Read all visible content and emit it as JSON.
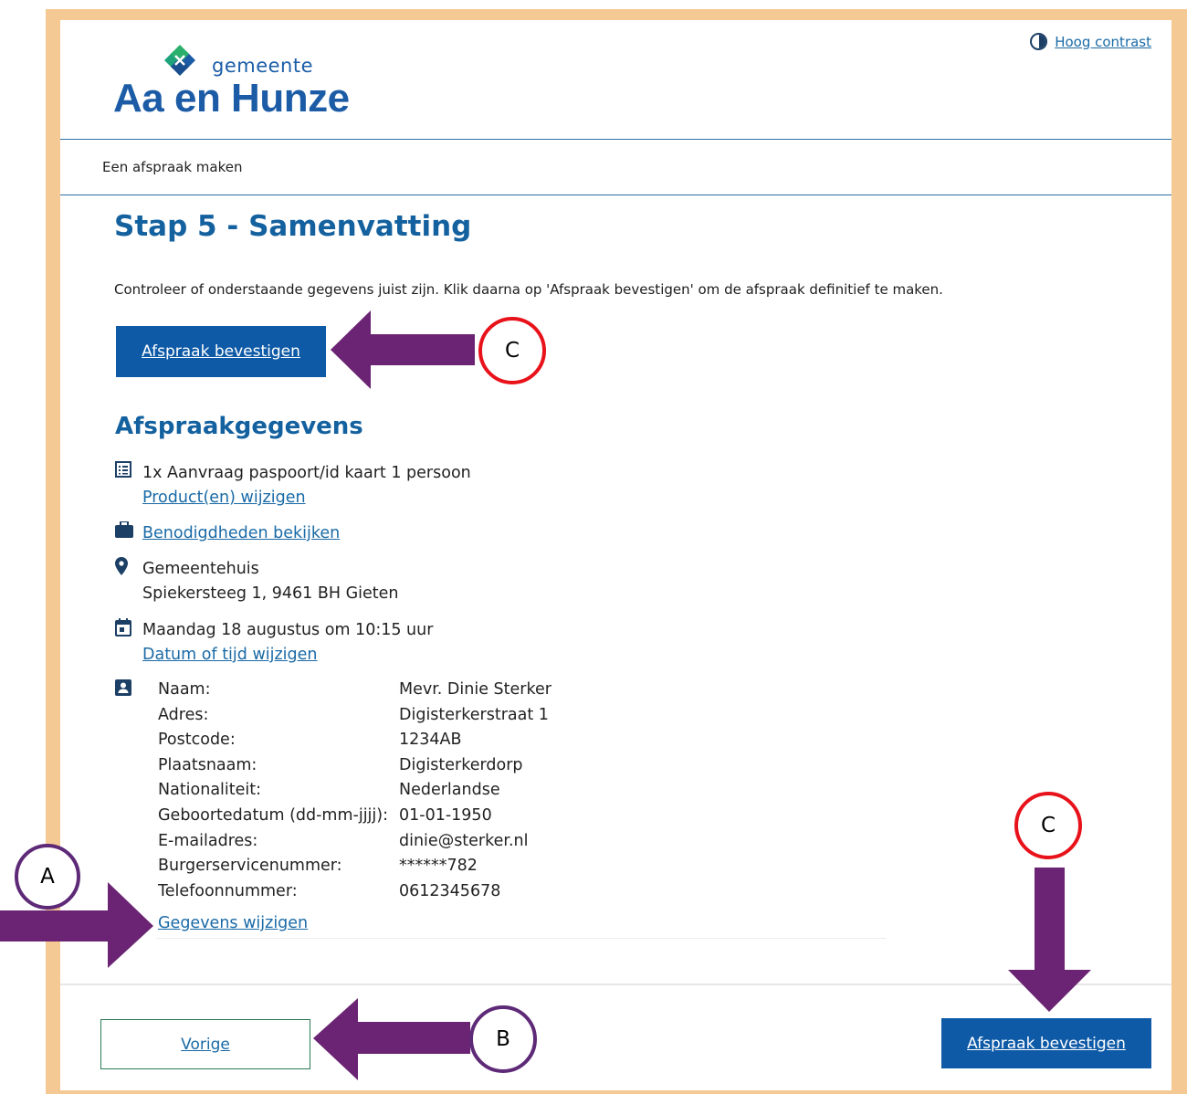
{
  "header": {
    "logo_top": "gemeente",
    "logo_main": "Aa en Hunze",
    "contrast_label": "Hoog contrast"
  },
  "breadcrumb": "Een afspraak maken",
  "page": {
    "title": "Stap 5 - Samenvatting",
    "intro": "Controleer of onderstaande gegevens juist zijn. Klik daarna op 'Afspraak bevestigen' om de afspraak definitief te maken.",
    "confirm_label": "Afspraak bevestigen",
    "section_title": "Afspraakgegevens"
  },
  "appointment": {
    "product": "1x Aanvraag paspoort/id kaart 1 persoon",
    "product_edit": "Product(en) wijzigen",
    "requirements": "Benodigdheden bekijken",
    "location_name": "Gemeentehuis",
    "location_address": "Spiekersteeg 1, 9461 BH Gieten",
    "datetime": "Maandag 18 augustus om 10:15 uur",
    "datetime_edit": "Datum of tijd wijzigen"
  },
  "personal": {
    "rows": [
      {
        "label": "Naam:",
        "value": "Mevr. Dinie Sterker"
      },
      {
        "label": "Adres:",
        "value": "Digisterkerstraat 1"
      },
      {
        "label": "Postcode:",
        "value": "1234AB"
      },
      {
        "label": "Plaatsnaam:",
        "value": "Digisterkerdorp"
      },
      {
        "label": "Nationaliteit:",
        "value": "Nederlandse"
      },
      {
        "label": "Geboortedatum (dd-mm-jjjj):",
        "value": "01-01-1950"
      },
      {
        "label": "E-mailadres:",
        "value": "dinie@sterker.nl"
      },
      {
        "label": "Burgerservicenummer:",
        "value": "******782"
      },
      {
        "label": "Telefoonnummer:",
        "value": "0612345678"
      }
    ],
    "edit_label": "Gegevens wijzigen"
  },
  "footer": {
    "prev_label": "Vorige",
    "confirm_label": "Afspraak bevestigen"
  },
  "annotations": {
    "a": "A",
    "b": "B",
    "c_top": "C",
    "c_bottom": "C",
    "arrow_color": "#6b2473",
    "circle_red": "#e8121b",
    "circle_purple": "#5e2a78"
  },
  "colors": {
    "frame": "#f5c993",
    "accent": "#0e5aa7",
    "heading": "#14619f",
    "link": "#1a6aa6"
  }
}
